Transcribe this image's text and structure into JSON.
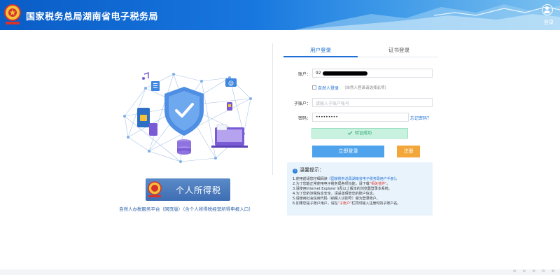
{
  "header": {
    "title": "国家税务总局湖南省电子税务局",
    "login_label": "登录",
    "emblem_icon": "tax-emblem-icon",
    "bg_start": "#0a5cc6",
    "bg_end": "#7cc1f0"
  },
  "left": {
    "banner_label": "个人所得税",
    "entry_link": "自然人办税服务平台（网页版）（含个人所得税经营所得申报入口）"
  },
  "tabs": [
    {
      "label": "用户登录",
      "active": true
    },
    {
      "label": "证书登录",
      "active": false
    }
  ],
  "form": {
    "account": {
      "label": "账户：",
      "value": "92"
    },
    "natural_person": {
      "label": "自然人登录",
      "note": "（自然人登录请选择此项）",
      "checked": false
    },
    "subaccount": {
      "label": "子账户：",
      "placeholder": "请输入子账户帐号"
    },
    "password": {
      "label": "密码：",
      "value": "•••••••••",
      "forgot": "忘记密码？"
    },
    "verify": {
      "label": "验证成功"
    },
    "login_button": "立即登录",
    "register_button": "注册"
  },
  "tips": {
    "title": "温馨提示：",
    "items": [
      {
        "pre": "1.使用前请您仔细阅读",
        "link": "《国家税务总局湖南省电子税务局用户手册》",
        "post": "。"
      },
      {
        "pre": "2.为了您能正常使用电子税务局各项功能，请下载",
        "link": "\"相关插件\"",
        "post": "。"
      },
      {
        "pre": "3.请使用Internet Explorer 9及以上版本的浏览器登录本系统。",
        "link": "",
        "post": ""
      },
      {
        "pre": "4.为了您的涉税信息安全，请妥善保管您的账户信息。",
        "link": "",
        "post": ""
      },
      {
        "pre": "5.请使用社会信用代码（纳税人识别号）做为登录账户。",
        "link": "",
        "post": ""
      },
      {
        "pre": "6.如果您是子账户用户，请在",
        "link": "\"子账户\"",
        "post": "栏同时输入注册时的子账户名。"
      }
    ]
  },
  "colors": {
    "primary": "#1d6fd3",
    "login_button": "#4ea3ec",
    "register_button": "#f3a73a",
    "verify_bg": "#c8f2df",
    "tips_bg": "#e9f3fc"
  }
}
